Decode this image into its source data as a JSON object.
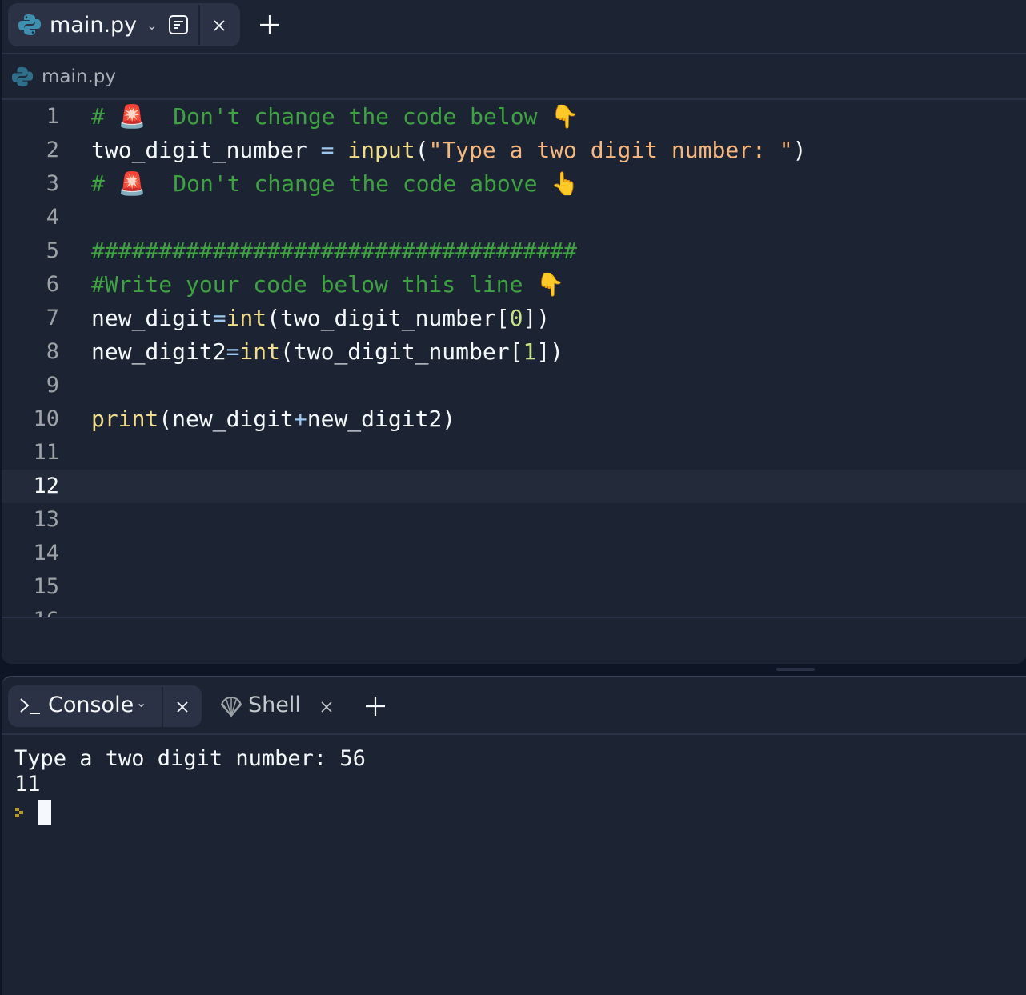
{
  "editor": {
    "tab": {
      "label": "main.py",
      "icon": "python-icon"
    },
    "file_header": {
      "label": "main.py"
    },
    "active_line": 12,
    "lines": [
      [
        [
          "# ",
          "comment"
        ],
        [
          "🚨",
          "emoji"
        ],
        [
          "  Don't change the code below ",
          "comment"
        ],
        [
          "👇",
          "emoji"
        ]
      ],
      [
        [
          "two_digit_number ",
          ""
        ],
        [
          "=",
          "op"
        ],
        [
          " ",
          ""
        ],
        [
          "input",
          "func"
        ],
        [
          "(",
          ""
        ],
        [
          "\"Type a two digit number: \"",
          "string"
        ],
        [
          ")",
          ""
        ]
      ],
      [
        [
          "# ",
          "comment"
        ],
        [
          "🚨",
          "emoji"
        ],
        [
          "  Don't change the code above ",
          "comment"
        ],
        [
          "👆",
          "emoji"
        ]
      ],
      [],
      [
        [
          "####################################",
          "comment"
        ]
      ],
      [
        [
          "#Write your code below this line ",
          "comment"
        ],
        [
          "👇",
          "emoji"
        ]
      ],
      [
        [
          "new_digit",
          ""
        ],
        [
          "=",
          "op"
        ],
        [
          "int",
          "func"
        ],
        [
          "(two_digit_number[",
          ""
        ],
        [
          "0",
          "num"
        ],
        [
          "])",
          ""
        ]
      ],
      [
        [
          "new_digit2",
          ""
        ],
        [
          "=",
          "op"
        ],
        [
          "int",
          "func"
        ],
        [
          "(two_digit_number[",
          ""
        ],
        [
          "1",
          "num"
        ],
        [
          "])",
          ""
        ]
      ],
      [],
      [
        [
          "print",
          "func"
        ],
        [
          "(new_digit",
          ""
        ],
        [
          "+",
          "op"
        ],
        [
          "new_digit2)",
          ""
        ]
      ],
      [],
      [],
      [],
      [],
      [],
      []
    ]
  },
  "console": {
    "tabs": [
      {
        "label": "Console",
        "icon": "terminal-icon"
      },
      {
        "label": "Shell",
        "icon": "shell-icon"
      }
    ],
    "output": [
      "Type a two digit number: 56",
      "11"
    ]
  },
  "colors": {
    "background": "#1c2333",
    "comment": "#3fa142",
    "function": "#f0dd8c",
    "string": "#f5b77e",
    "number": "#c6e38c",
    "operator": "#9fc8f0",
    "prompt": "#b59a2a"
  }
}
